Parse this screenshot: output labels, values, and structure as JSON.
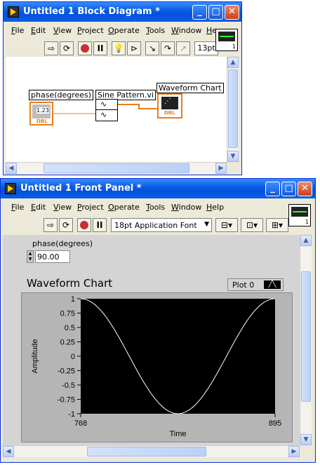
{
  "block_diagram": {
    "title": "Untitled 1 Block Diagram *",
    "menu": [
      "File",
      "Edit",
      "View",
      "Project",
      "Operate",
      "Tools",
      "Window",
      "He"
    ],
    "toolbar_font": "13pt",
    "icon_number": "1",
    "nodes": {
      "phase_label": "phase(degrees)",
      "phase_value": "1.23",
      "phase_type": "DBL",
      "sine_label": "Sine Pattern.vi",
      "chart_label": "Waveform Chart",
      "chart_type": "DBL"
    }
  },
  "front_panel": {
    "title": "Untitled 1 Front Panel *",
    "menu": [
      "File",
      "Edit",
      "View",
      "Project",
      "Operate",
      "Tools",
      "Window",
      "Help"
    ],
    "font_select": "18pt Application Font",
    "icon_number": "1",
    "phase_label": "phase(degrees)",
    "phase_value": "90.00"
  },
  "chart_data": {
    "type": "line",
    "title": "Waveform Chart",
    "xlabel": "Time",
    "ylabel": "Amplitude",
    "x_ticks": [
      "768",
      "895"
    ],
    "y_ticks": [
      "1",
      "0.75",
      "0.5",
      "0.25",
      "0",
      "-0.25",
      "-0.5",
      "-0.75",
      "-1"
    ],
    "xlim": [
      768,
      895
    ],
    "ylim": [
      -1,
      1
    ],
    "grid": false,
    "legend": "top-right",
    "series": [
      {
        "name": "Plot 0",
        "function": "cos",
        "periods": 1,
        "color": "#ffffff"
      }
    ],
    "background": "#000000"
  }
}
